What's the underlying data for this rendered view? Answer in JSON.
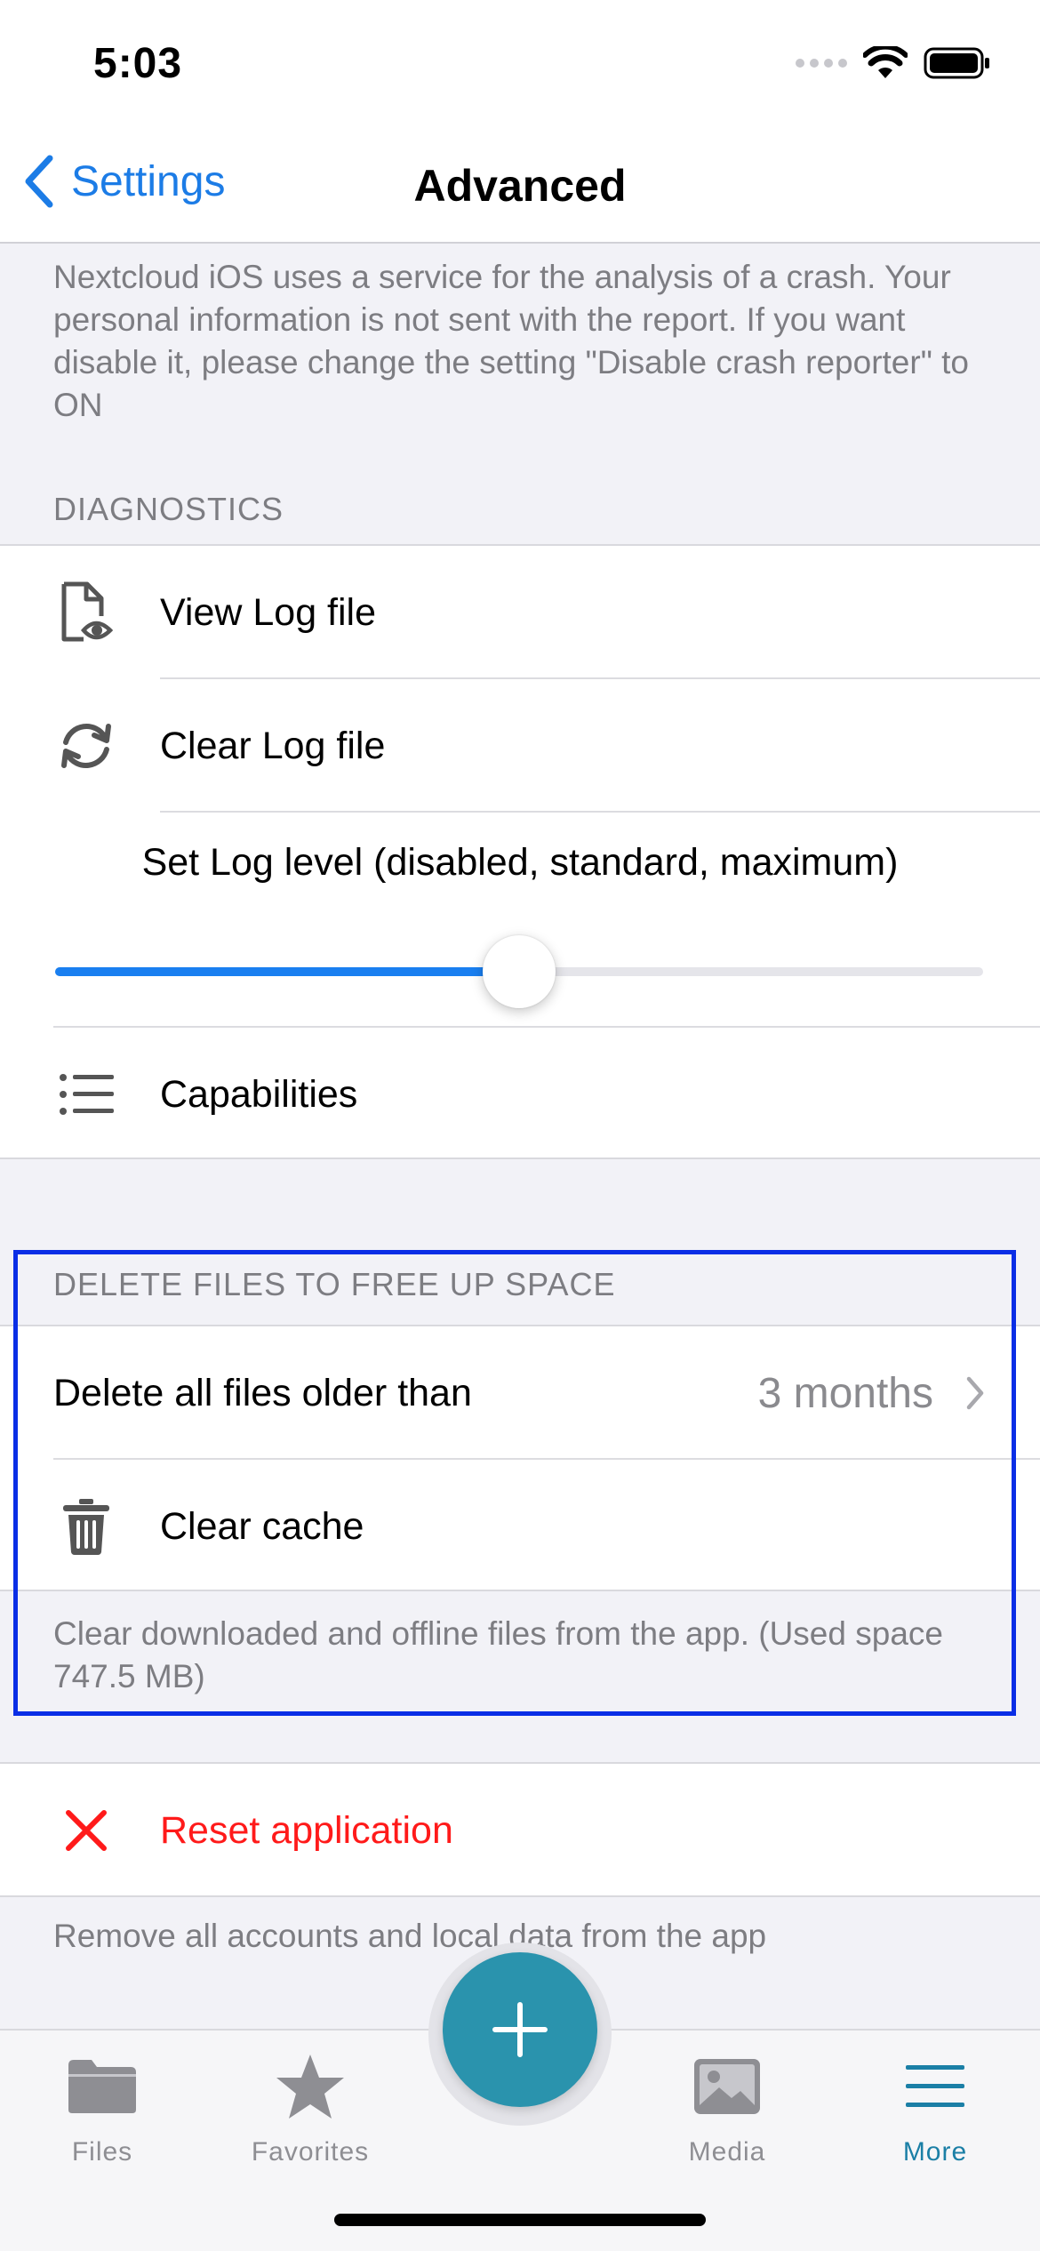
{
  "status_bar": {
    "time": "5:03"
  },
  "nav": {
    "back_label": "Settings",
    "title": "Advanced"
  },
  "crash_info": "Nextcloud iOS uses a service for the analysis of a crash. Your personal information is not sent with the report. If you want disable it, please change the setting \"Disable crash reporter\" to ON",
  "diagnostics": {
    "header": "DIAGNOSTICS",
    "view_log": {
      "label": "View Log file",
      "icon": "document-eye-icon"
    },
    "clear_log": {
      "label": "Clear Log file",
      "icon": "refresh-icon"
    },
    "log_level": {
      "label": "Set Log level (disabled, standard, maximum)",
      "value": 0.5
    },
    "capabilities": {
      "label": "Capabilities",
      "icon": "list-icon"
    }
  },
  "delete_files": {
    "header": "DELETE FILES TO FREE UP SPACE",
    "older_than": {
      "label": "Delete all files older than",
      "value": "3 months"
    },
    "clear_cache": {
      "label": "Clear cache",
      "icon": "trash-icon"
    },
    "footer": "Clear downloaded and offline files from the app. (Used space 747.5 MB)"
  },
  "reset": {
    "label": "Reset application",
    "icon": "close-icon",
    "footer": "Remove all accounts and local data from the app",
    "color": "#ff1a1a"
  },
  "tab_bar": {
    "tabs": [
      {
        "label": "Files",
        "icon": "folder-icon"
      },
      {
        "label": "Favorites",
        "icon": "star-icon"
      },
      {
        "label": "Media",
        "icon": "photo-icon"
      },
      {
        "label": "More",
        "icon": "menu-icon"
      }
    ],
    "active": "More"
  },
  "colors": {
    "accent": "#1c7ce6",
    "brand": "#2a93ad",
    "highlight": "#0a2ee6"
  }
}
